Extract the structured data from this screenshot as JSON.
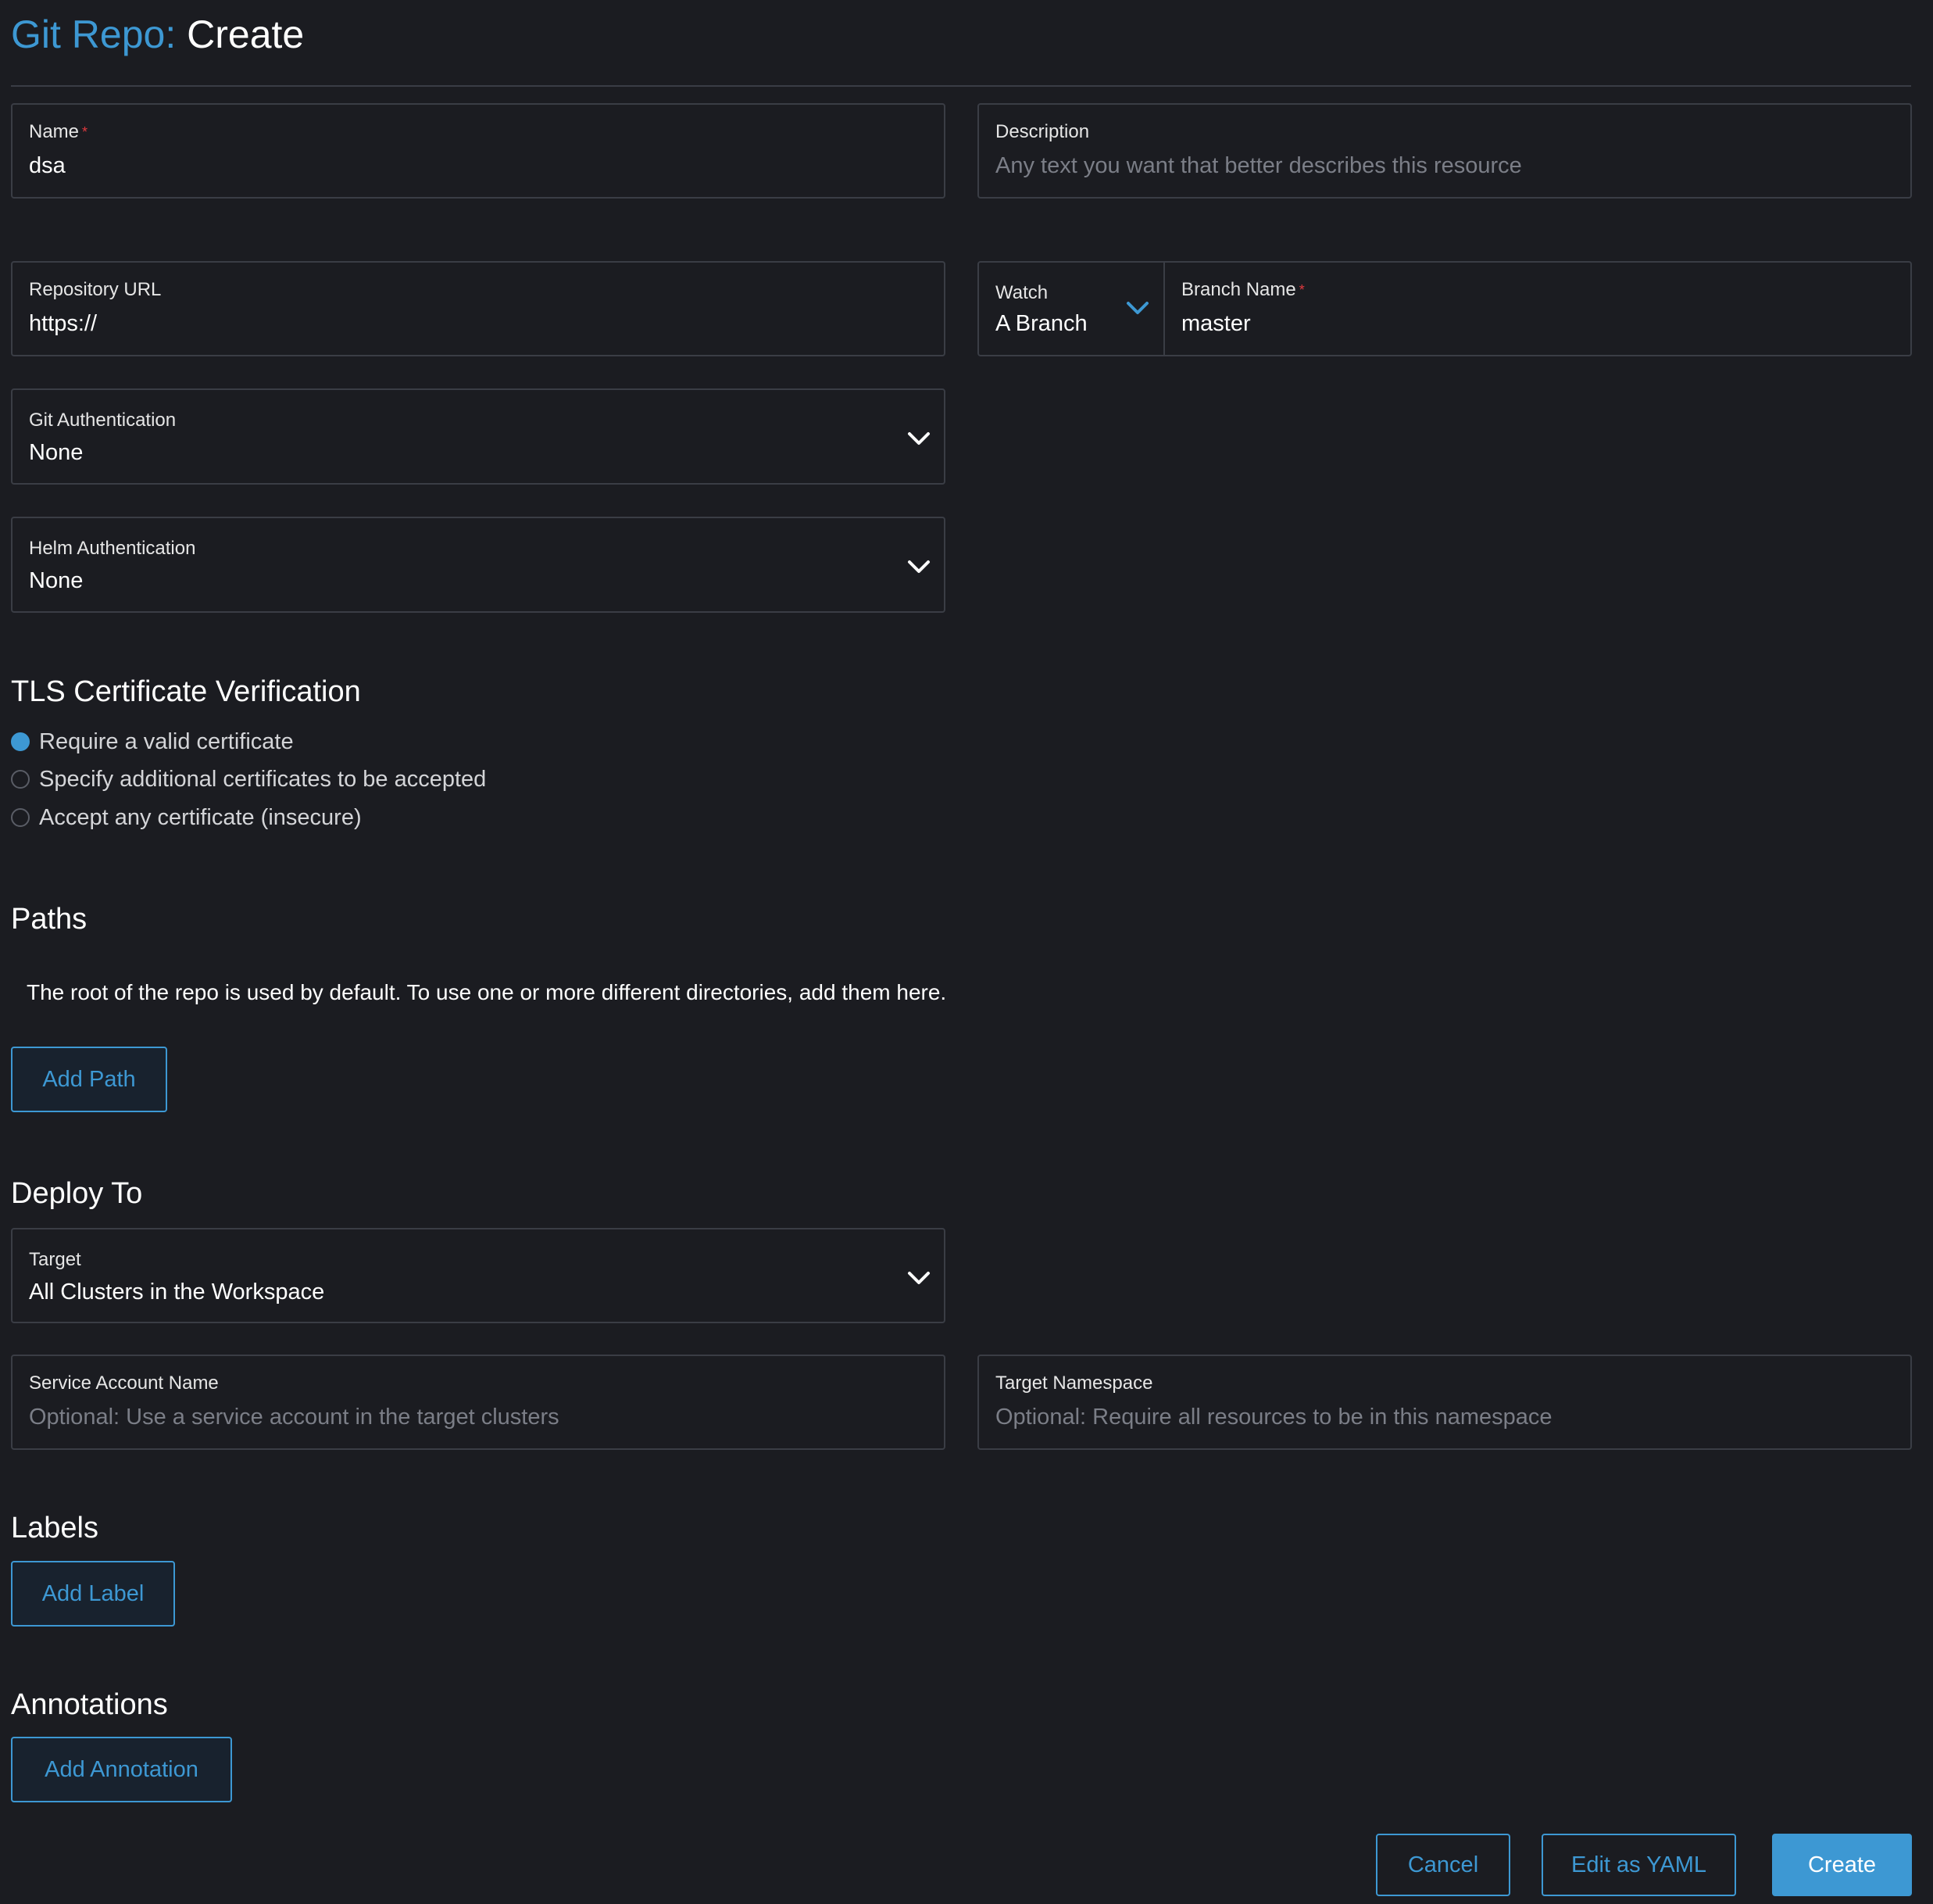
{
  "header": {
    "crumb": "Git Repo:",
    "action": "Create"
  },
  "form": {
    "name": {
      "label": "Name",
      "required_mark": "*",
      "value": "dsa"
    },
    "description": {
      "label": "Description",
      "placeholder": "Any text you want that better describes this resource"
    },
    "repo_url": {
      "label": "Repository URL",
      "value": "https://"
    },
    "watch": {
      "label": "Watch",
      "value": "A Branch"
    },
    "branch": {
      "label": "Branch Name",
      "required_mark": "*",
      "value": "master"
    },
    "git_auth": {
      "label": "Git Authentication",
      "value": "None"
    },
    "helm_auth": {
      "label": "Helm Authentication",
      "value": "None"
    }
  },
  "tls": {
    "title": "TLS Certificate Verification",
    "options": [
      {
        "label": "Require a valid certificate",
        "checked": true
      },
      {
        "label": "Specify additional certificates to be accepted",
        "checked": false
      },
      {
        "label": "Accept any certificate (insecure)",
        "checked": false
      }
    ]
  },
  "paths": {
    "title": "Paths",
    "description": "The root of the repo is used by default. To use one or more different directories, add them here.",
    "add_label": "Add Path"
  },
  "deploy": {
    "title": "Deploy To",
    "target": {
      "label": "Target",
      "value": "All Clusters in the Workspace"
    },
    "service_account": {
      "label": "Service Account Name",
      "placeholder": "Optional: Use a service account in the target clusters"
    },
    "target_namespace": {
      "label": "Target Namespace",
      "placeholder": "Optional: Require all resources to be in this namespace"
    }
  },
  "labels": {
    "title": "Labels",
    "add_label": "Add Label"
  },
  "annotations": {
    "title": "Annotations",
    "add_label": "Add Annotation"
  },
  "footer": {
    "cancel": "Cancel",
    "edit_yaml": "Edit as YAML",
    "create": "Create"
  },
  "colors": {
    "accent": "#3d98d3",
    "background": "#1b1c21",
    "border": "#3a3d45",
    "required": "#e0393e"
  },
  "icons": {
    "dropdown": "chevron-down-icon"
  }
}
